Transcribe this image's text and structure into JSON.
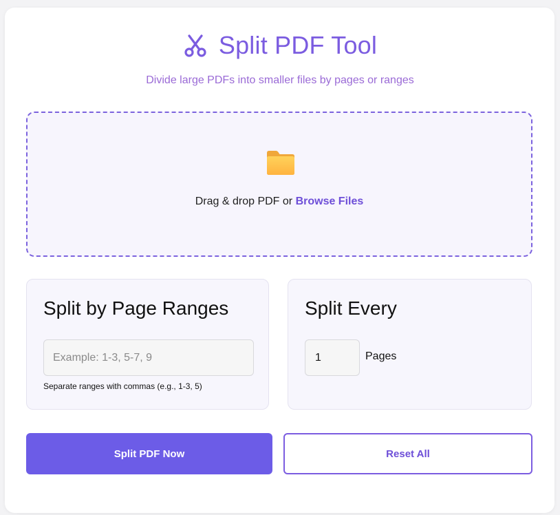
{
  "header": {
    "icon": "scissors-icon",
    "title": "Split PDF Tool",
    "subtitle": "Divide large PDFs into smaller files by pages or ranges"
  },
  "dropzone": {
    "icon": "folder-icon",
    "text": "Drag & drop PDF or ",
    "browse_label": "Browse Files"
  },
  "range_panel": {
    "title": "Split by Page Ranges",
    "input_value": "",
    "input_placeholder": "Example: 1-3, 5-7, 9",
    "hint": "Separate ranges with commas (e.g., 1-3, 5)"
  },
  "every_panel": {
    "title": "Split Every",
    "input_value": "1",
    "unit_label": "Pages"
  },
  "actions": {
    "split_label": "Split PDF Now",
    "reset_label": "Reset All"
  },
  "colors": {
    "accent": "#6c5ce7",
    "title": "#7b5ce0",
    "subtitle": "#9a6ad6",
    "folder": "#ffc24d"
  }
}
